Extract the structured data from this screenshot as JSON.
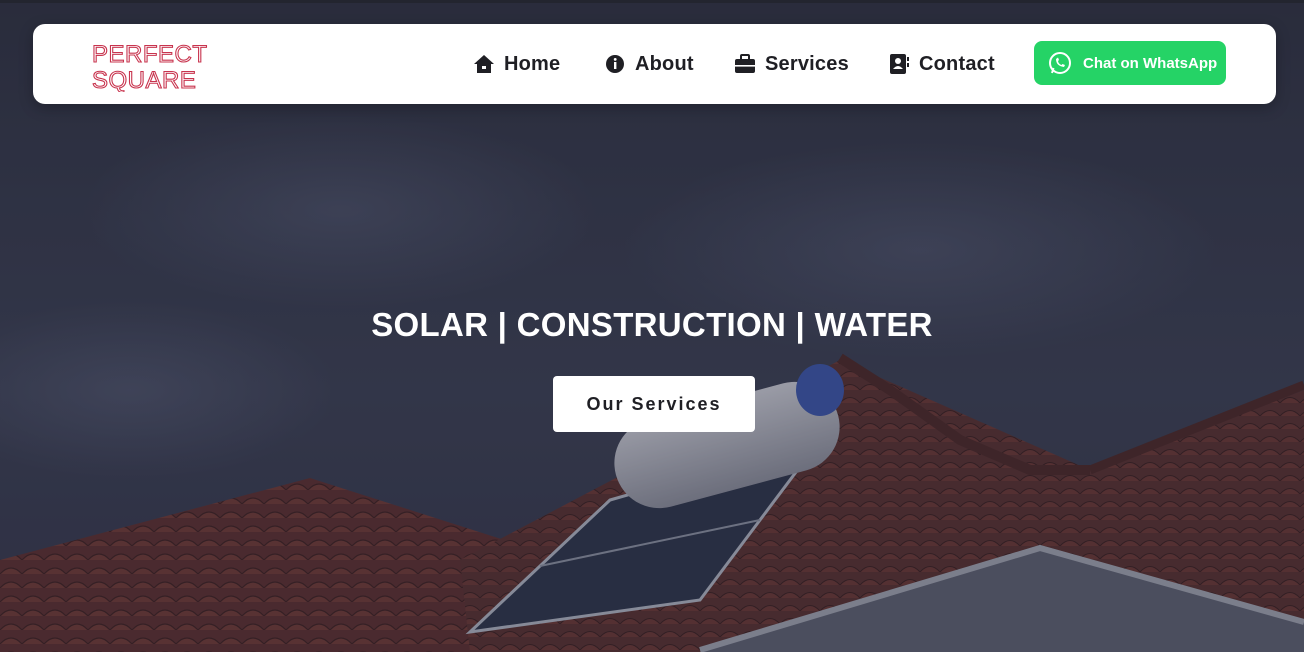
{
  "brand": {
    "logo_line1": "PERFECT",
    "logo_line2": "SQUARE",
    "logo_color": "#c8344e"
  },
  "nav": {
    "items": [
      {
        "label": "Home",
        "icon": "home-icon"
      },
      {
        "label": "About",
        "icon": "info-icon"
      },
      {
        "label": "Services",
        "icon": "briefcase-icon"
      },
      {
        "label": "Contact",
        "icon": "contact-book-icon"
      }
    ],
    "whatsapp_label": "Chat on WhatsApp",
    "whatsapp_icon": "whatsapp-icon",
    "whatsapp_color": "#25d366"
  },
  "hero": {
    "headline": "SOLAR | CONSTRUCTION | WATER",
    "cta_label": "Our Services"
  }
}
